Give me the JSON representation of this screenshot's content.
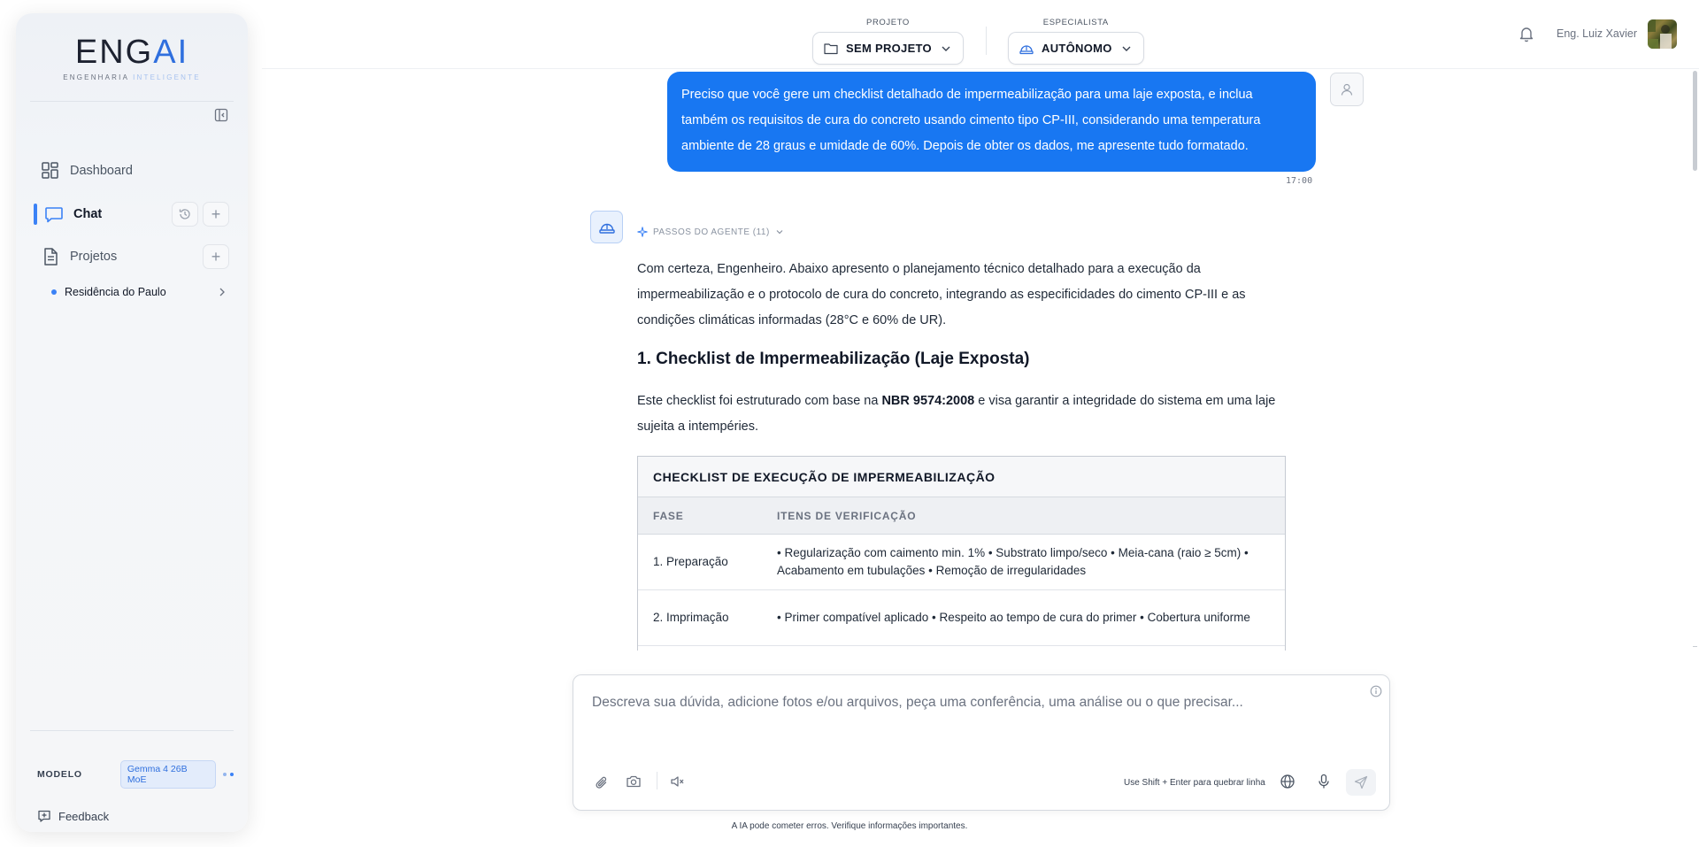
{
  "sidebar": {
    "logo_main_a": "ENG",
    "logo_main_b": "AI",
    "logo_sub_a": "ENGENHARIA",
    "logo_sub_b": "INTELIGENTE",
    "nav": {
      "dashboard": "Dashboard",
      "chat": "Chat",
      "projetos": "Projetos"
    },
    "projects": [
      "Residência do Paulo"
    ],
    "model_label": "MODELO",
    "model_value": "Gemma 4 26B MoE",
    "feedback": "Feedback"
  },
  "header": {
    "projeto_caption": "PROJETO",
    "projeto_value": "SEM PROJETO",
    "especialista_caption": "ESPECIALISTA",
    "especialista_value": "AUTÔNOMO",
    "user_name": "Eng. Luiz Xavier"
  },
  "chat": {
    "user_message": "Preciso que você gere um checklist detalhado de impermeabilização para uma laje exposta, e inclua também os requisitos de cura do concreto usando cimento tipo CP-III, considerando uma temperatura ambiente de 28 graus e umidade de 60%. Depois de obter os dados, me apresente tudo formatado.",
    "user_time": "17:00",
    "agent_steps": "PASSOS DO AGENTE (11)",
    "answer_intro": "Com certeza, Engenheiro. Abaixo apresento o planejamento técnico detalhado para a execução da impermeabilização e o protocolo de cura do concreto, integrando as especificidades do cimento CP-III e as condições climáticas informadas (28°C e 60% de UR).",
    "section_title": "1. Checklist de Impermeabilização (Laje Exposta)",
    "section_text_a": "Este checklist foi estruturado com base na ",
    "section_text_bold": "NBR 9574:2008",
    "section_text_b": " e visa garantir a integridade do sistema em uma laje sujeita a intempéries.",
    "table": {
      "title": "CHECKLIST DE EXECUÇÃO DE IMPERMEABILIZAÇÃO",
      "headers": [
        "FASE",
        "ITENS DE VERIFICAÇÃO"
      ],
      "rows": [
        [
          "1. Preparação",
          "• Regularização com caimento min. 1% • Substrato limpo/seco • Meia-cana (raio ≥ 5cm) • Acabamento em tubulações • Remoção de irregularidades"
        ],
        [
          "2. Imprimação",
          "• Primer compatível aplicado • Respeito ao tempo de cura do primer • Cobertura uniforme"
        ]
      ]
    }
  },
  "composer": {
    "placeholder": "Descreva sua dúvida, adicione fotos e/ou arquivos, peça uma conferência, uma análise ou o que precisar...",
    "hint": "Use Shift + Enter para quebrar linha",
    "disclaimer": "A IA pode cometer erros. Verifique informações importantes."
  },
  "colors": {
    "accent": "#1877f2",
    "brand_blue": "#2f6fde",
    "active_indicator": "#3b82f6"
  },
  "icons": [
    "sidebar-collapse-icon",
    "dashboard-icon",
    "chat-icon",
    "history-icon",
    "plus-icon",
    "document-icon",
    "chevron-right-icon",
    "folder-icon",
    "hard-hat-icon",
    "chevron-down-icon",
    "bell-icon",
    "user-icon",
    "sparkle-icon",
    "info-icon",
    "paperclip-icon",
    "camera-icon",
    "speaker-muted-icon",
    "globe-icon",
    "microphone-icon",
    "send-icon",
    "feedback-icon"
  ]
}
